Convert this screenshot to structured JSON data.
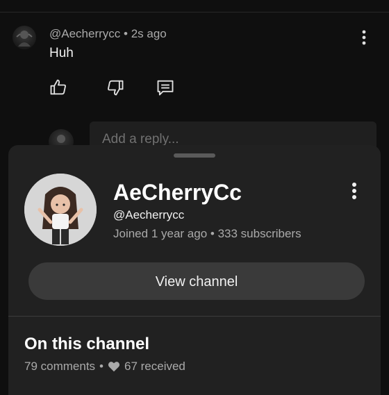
{
  "comment": {
    "author": "@Aecherrycc",
    "time": "2s ago",
    "text": "Huh"
  },
  "reply": {
    "placeholder": "Add a reply..."
  },
  "channel": {
    "name": "AeCherryCc",
    "handle": "@Aecherrycc",
    "joined": "Joined 1 year ago",
    "subscribers": "333 subscribers",
    "view_button": "View channel",
    "section_title": "On this channel",
    "comments": "79 comments",
    "received": "67 received"
  },
  "colors": {
    "background": "#0f0f0f",
    "sheet": "#212121",
    "button": "#3a3a3a",
    "secondary_text": "#aaaaaa"
  }
}
